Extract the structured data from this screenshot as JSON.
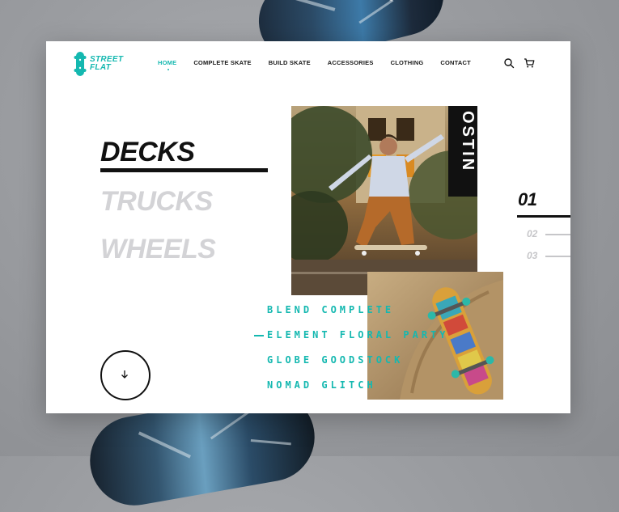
{
  "brand": {
    "line1": "STREET",
    "line2": "FLAT",
    "accent_color": "#14b8b0"
  },
  "nav": {
    "items": [
      {
        "label": "HOME",
        "active": true
      },
      {
        "label": "COMPLETE SKATE",
        "active": false
      },
      {
        "label": "BUILD SKATE",
        "active": false
      },
      {
        "label": "ACCESSORIES",
        "active": false
      },
      {
        "label": "CLOTHING",
        "active": false
      },
      {
        "label": "CONTACT",
        "active": false
      }
    ]
  },
  "header_icons": {
    "search": "search-icon",
    "cart": "cart-icon"
  },
  "categories": [
    {
      "label": "DECKS",
      "active": true
    },
    {
      "label": "TRUCKS",
      "active": false
    },
    {
      "label": "WHEELS",
      "active": false
    }
  ],
  "hero": {
    "rider_name": "OSTIN"
  },
  "products": [
    {
      "label": "BLEND COMPLETE",
      "selected": false
    },
    {
      "label": "ELEMENT FLORAL PARTY",
      "selected": true
    },
    {
      "label": "GLOBE GOODSTOCK",
      "selected": false
    },
    {
      "label": "NOMAD GLITCH",
      "selected": false
    }
  ],
  "slider": {
    "current": "01",
    "others": [
      "02",
      "03"
    ]
  },
  "scroll_button": {
    "icon": "arrow-down-icon"
  }
}
